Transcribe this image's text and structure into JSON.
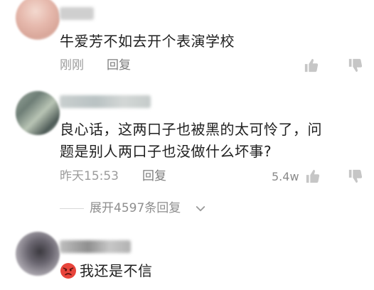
{
  "comments": [
    {
      "text": "牛爱芳不如去开个表演学校",
      "author_handle": "刚刚",
      "reply_label": "回复"
    },
    {
      "text_line1": "良心话，这两口子也被黑的太可怜了，问",
      "text_line2": "题是别人两口子也没做什么坏事?",
      "time": "昨天15:53",
      "reply_label": "回复",
      "like_count": "5.4w",
      "expand_label": "展开4597条回复"
    },
    {
      "text": "我还是不信"
    }
  ],
  "colors": {
    "like_icon": "#c4c4c4",
    "meta_text": "#9b9b9b",
    "emoji_red": "#e8453c"
  },
  "icons": [
    "thumbs-up-icon",
    "thumbs-down-icon",
    "chevron-down-icon",
    "angry-face-emoji"
  ]
}
